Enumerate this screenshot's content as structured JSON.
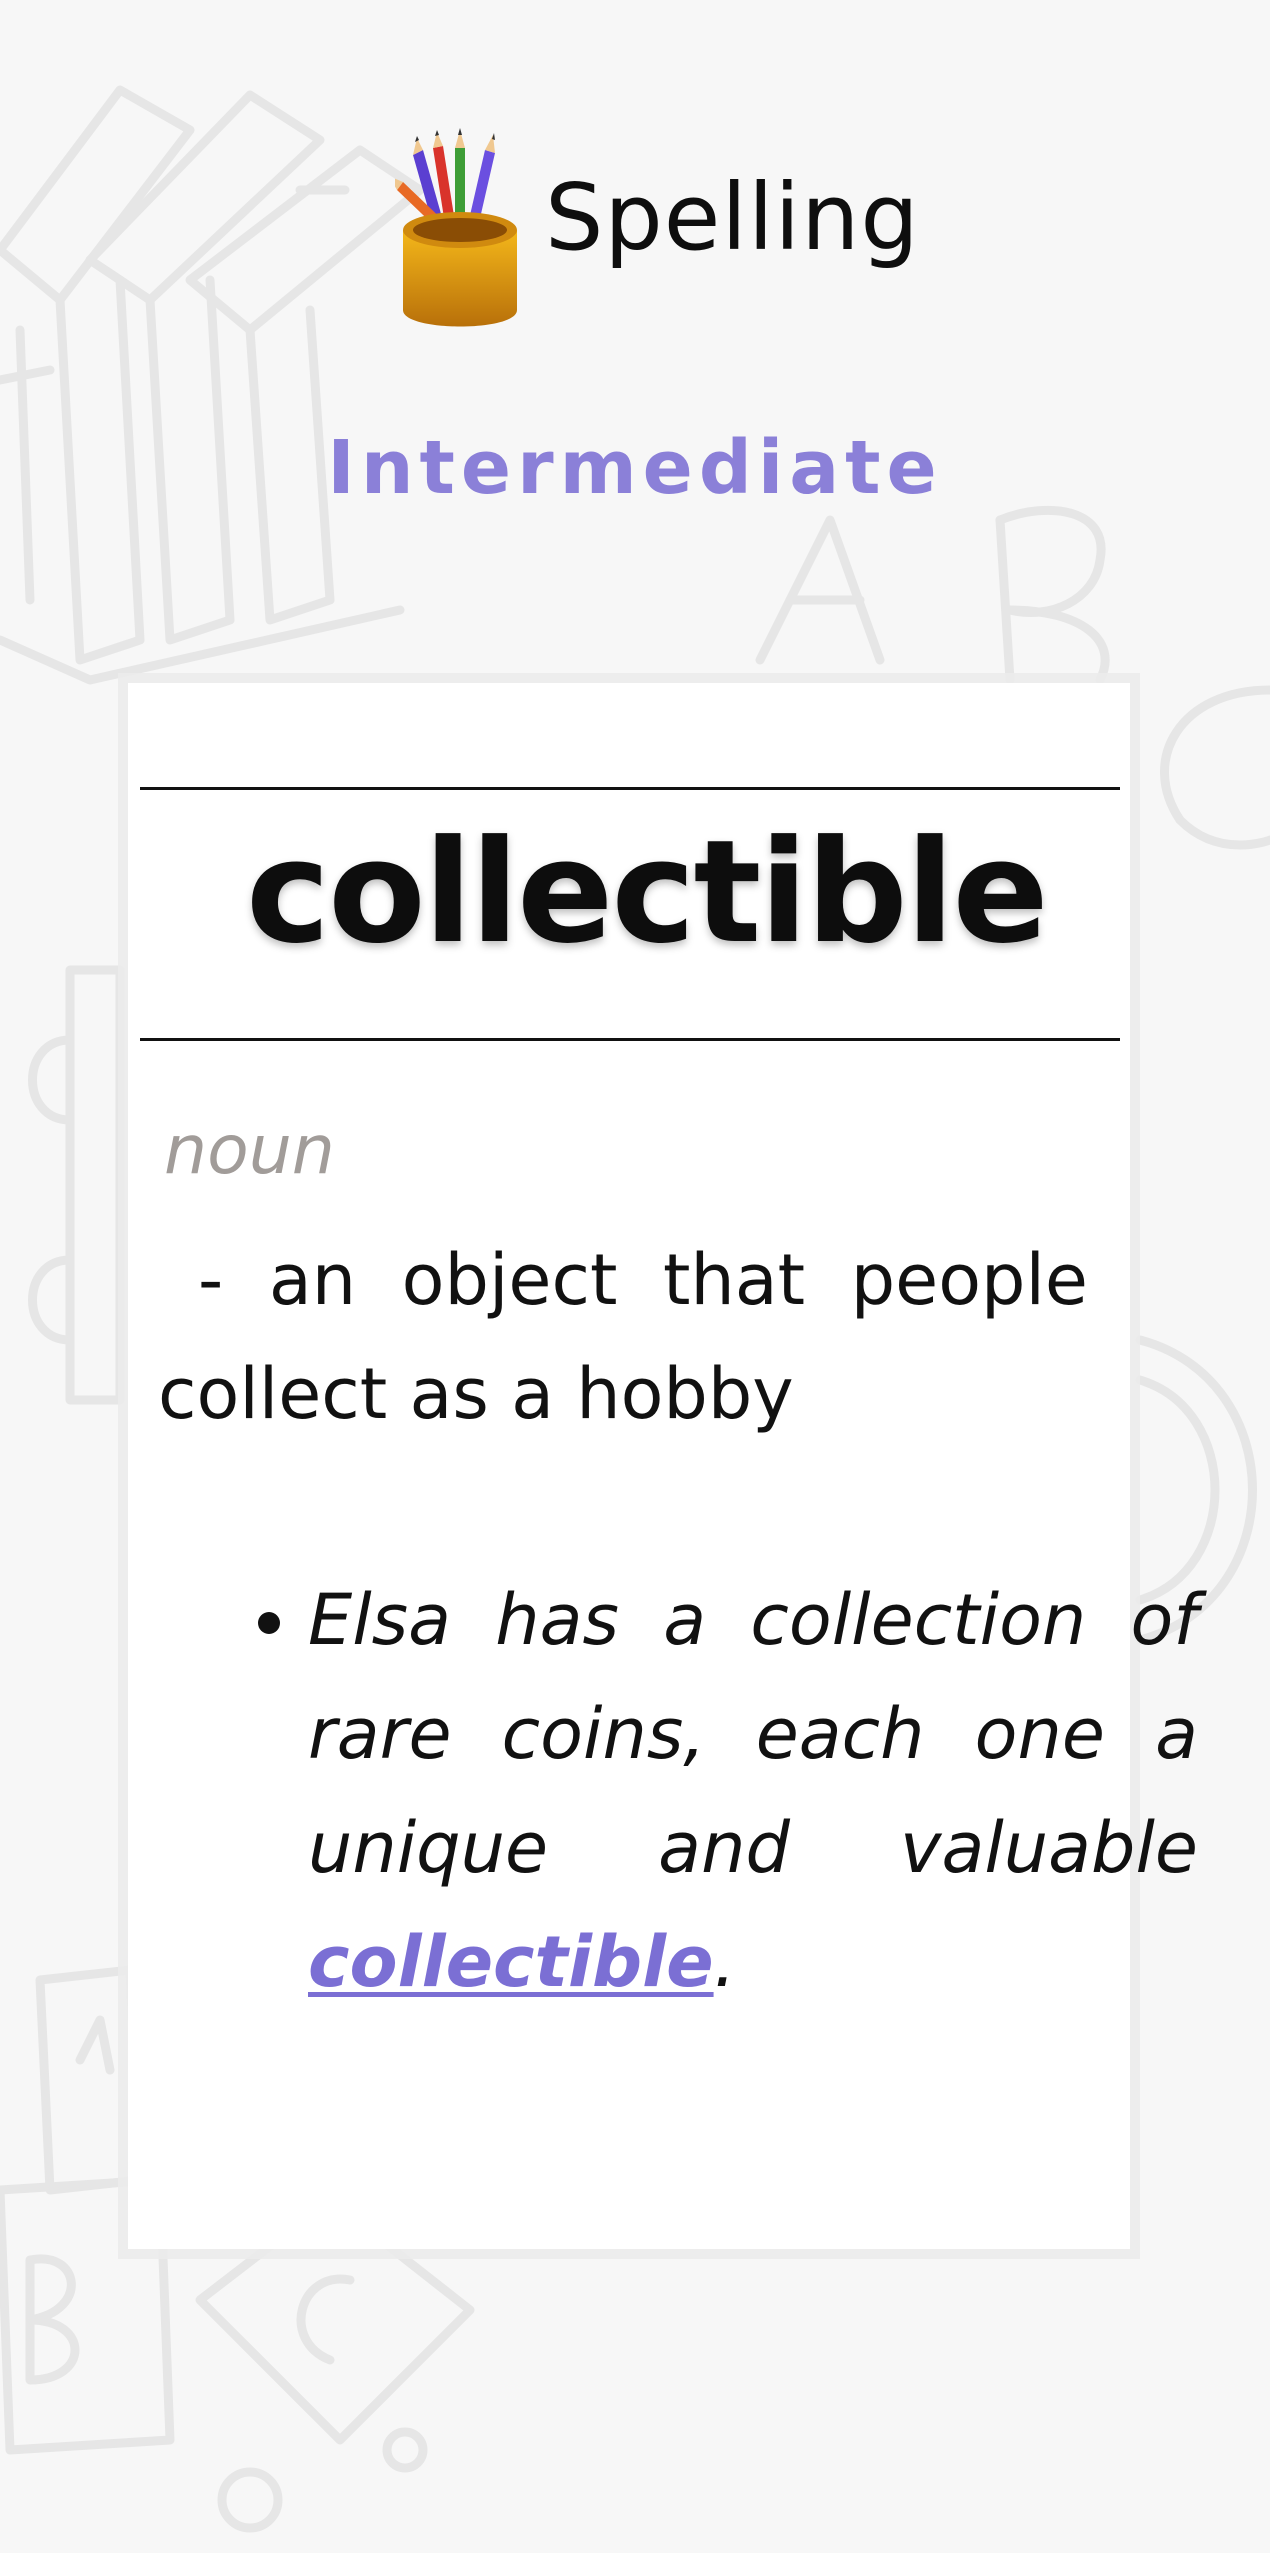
{
  "header": {
    "title": "Spelling",
    "icon": "pencil-cup-icon",
    "level": "Intermediate"
  },
  "card": {
    "word": "collectible",
    "part_of_speech": "noun",
    "definition": "- an object that people collect as a hobby",
    "example": {
      "before": "Elsa has a collection of rare coins, each one a unique and valuable ",
      "highlight": "collectible",
      "after": "."
    }
  },
  "colors": {
    "background": "#f7f7f7",
    "accent": "#8b80d8",
    "highlight": "#7b6fd4",
    "part_of_speech": "#a19c99"
  }
}
